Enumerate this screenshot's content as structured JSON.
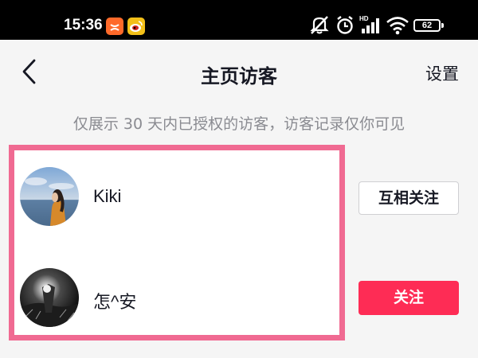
{
  "status_bar": {
    "time": "15:36",
    "battery": "62",
    "notification_icons": [
      "taobao-icon",
      "weibo-icon"
    ],
    "right_icons": [
      "mute-icon",
      "alarm-icon",
      "hd-signal-icon",
      "wifi-icon",
      "battery-icon"
    ]
  },
  "nav": {
    "title": "主页访客",
    "settings_label": "设置",
    "back_icon": "chevron-left-icon"
  },
  "notice": "仅展示 30 天内已授权的访客，访客记录仅你可见",
  "visitors": [
    {
      "name": "Kiki",
      "button_label": "互相关注"
    },
    {
      "name": "怎^安",
      "button_label": "关注"
    }
  ],
  "colors": {
    "accent": "#fe2c55",
    "highlight_border": "#f06a92",
    "taobao": "#ff6a2a",
    "weibo": "#f3c019"
  }
}
